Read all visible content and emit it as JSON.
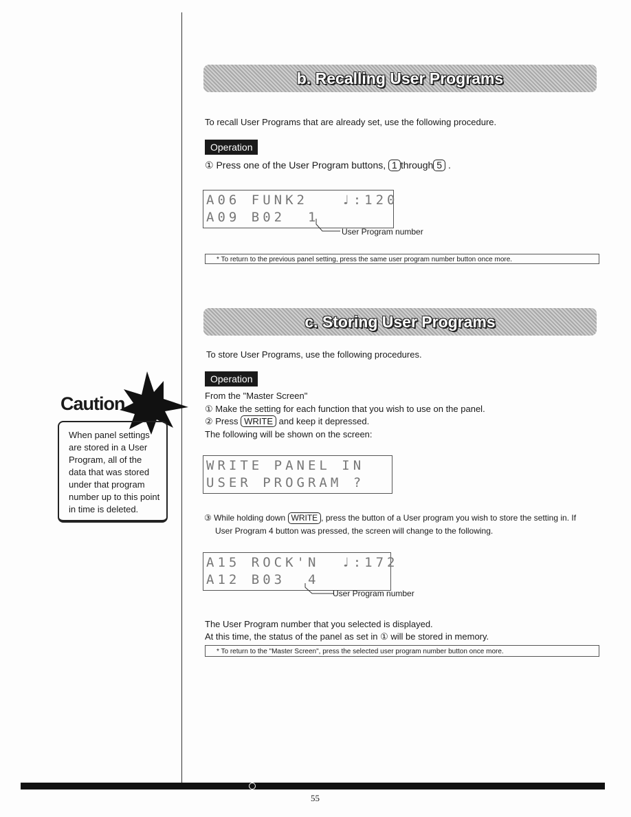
{
  "section_b": {
    "title": "b. Recalling User Programs",
    "intro": "To recall User Programs that are already set, use the following procedure.",
    "operation_label": "Operation",
    "step1_prefix": "① Press one of the User Program buttons,",
    "key_first": "1",
    "step1_mid": "through",
    "key_last": "5",
    "step1_suffix": ".",
    "lcd_line1": "A06 FUNK2   ♩:120",
    "lcd_line2": "A09 B02  1",
    "callout": "User Program number",
    "note": "* To return to the previous panel setting, press the same user program number button once more."
  },
  "section_c": {
    "title": "c. Storing User Programs",
    "intro": "To store User Programs, use the following procedures.",
    "operation_label": "Operation",
    "from": "From the \"Master Screen\"",
    "step1": "① Make the setting for each function that you wish to use on the panel.",
    "step2_prefix": "② Press",
    "write_key": "WRITE",
    "step2_suffix": "and keep it depressed.",
    "following": "The following will be shown on the screen:",
    "lcd1_line1": "WRITE PANEL IN",
    "lcd1_line2": "USER PROGRAM ?",
    "step3_prefix": "③ While holding down",
    "step3_suffix": ", press the button of a User program you wish to store the setting in. If",
    "step3_line2": "User Program 4 button was pressed, the screen will change to the following.",
    "lcd2_line1": "A15 ROCK'N  ♩:172",
    "lcd2_line2": "A12 B03  4",
    "callout": "User Program number",
    "result1": "The User Program number that you selected is displayed.",
    "result2": "At this time, the status of the panel as set in ① will be stored in memory.",
    "note": "* To return to  the \"Master Screen\", press the selected user program number button once more."
  },
  "caution": {
    "title": "Caution",
    "body": "When panel settings are stored in a User Program, all of the data that was stored under that program number up to this point in time is deleted."
  },
  "page_number": "55"
}
